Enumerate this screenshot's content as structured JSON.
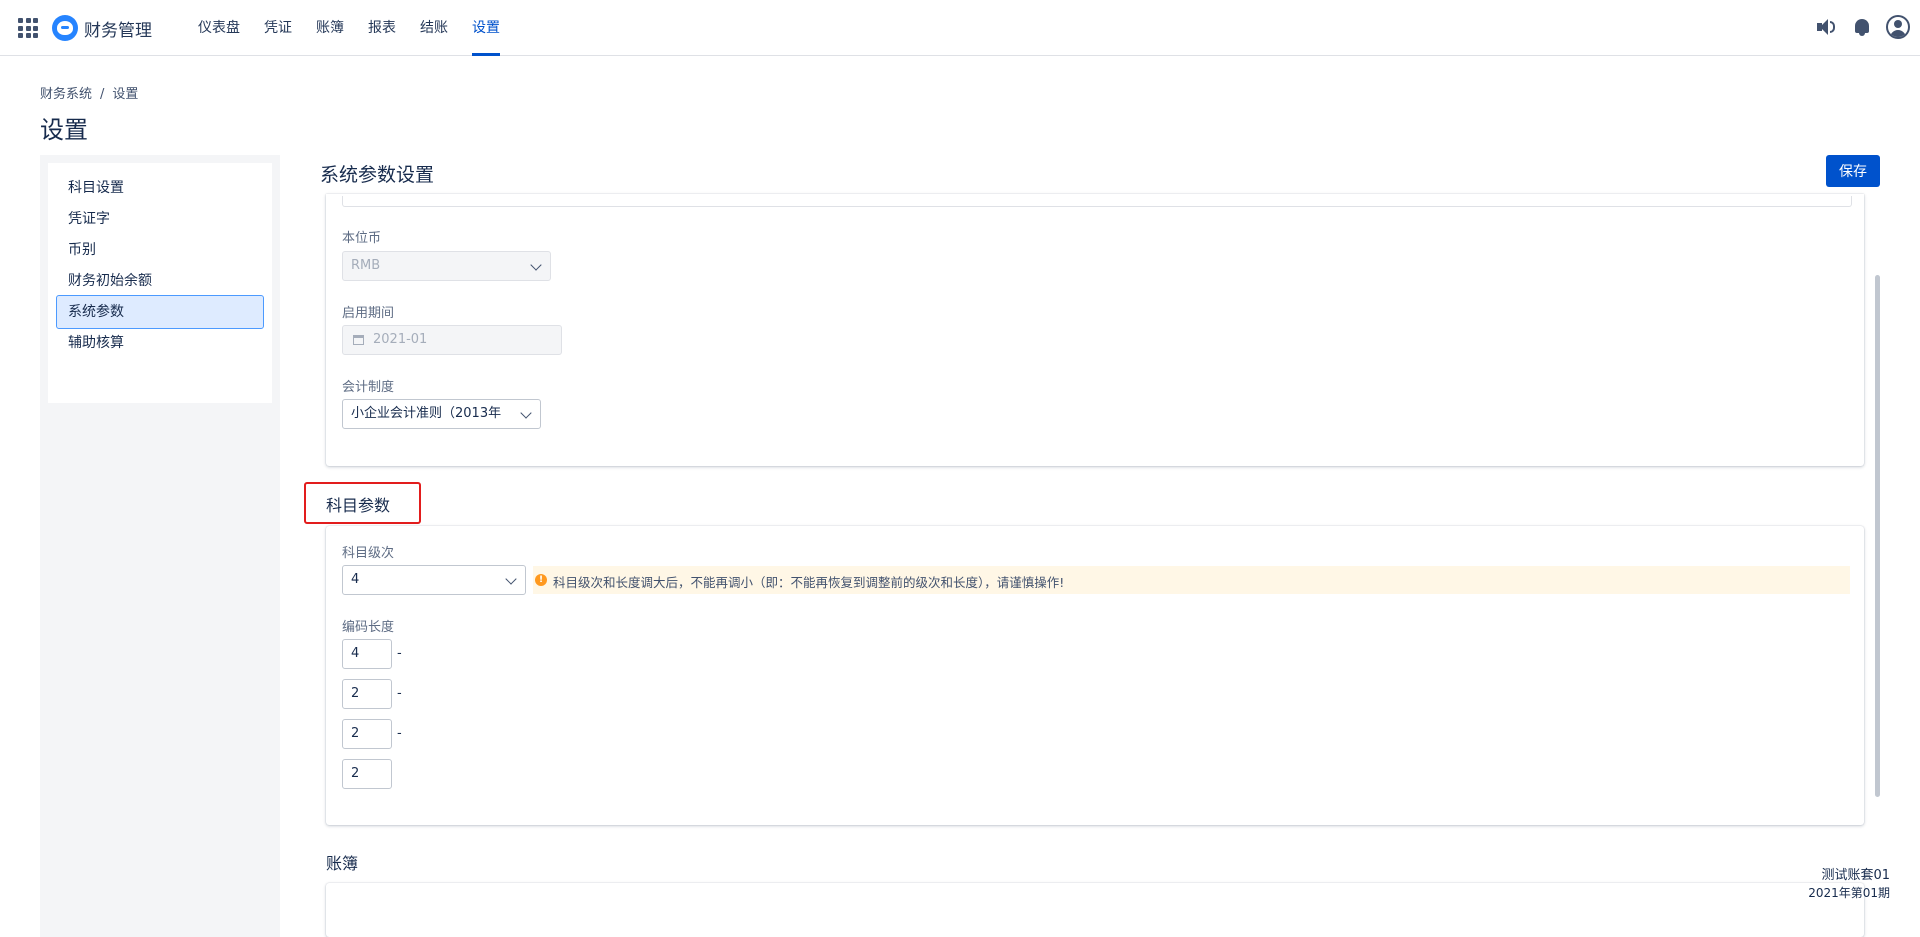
{
  "app": {
    "title": "财务管理",
    "nav": [
      "仪表盘",
      "凭证",
      "账簿",
      "报表",
      "结账",
      "设置"
    ],
    "active_nav": "设置"
  },
  "breadcrumb": [
    "财务系统",
    "设置"
  ],
  "page_title": "设置",
  "sidebar": {
    "items": [
      {
        "label": "科目设置"
      },
      {
        "label": "凭证字"
      },
      {
        "label": "币别"
      },
      {
        "label": "财务初始余额"
      },
      {
        "label": "系统参数",
        "active": true
      },
      {
        "label": "辅助核算"
      }
    ]
  },
  "main": {
    "section_title": "系统参数设置",
    "save_label": "保存",
    "base_currency": {
      "label": "本位币",
      "value": "RMB"
    },
    "start_period": {
      "label": "启用期间",
      "value": "2021-01"
    },
    "accounting_system": {
      "label": "会计制度",
      "value": "小企业会计准则（2013年"
    },
    "subject_params": {
      "title": "科目参数",
      "level": {
        "label": "科目级次",
        "value": "4"
      },
      "warning": "科目级次和长度调大后，不能再调小（即：不能再恢复到调整前的级次和长度），请谨慎操作!",
      "code_length": {
        "label": "编码长度",
        "values": [
          "4",
          "2",
          "2",
          "2"
        ],
        "separator": "-"
      }
    },
    "ledger_title": "账簿"
  },
  "footer": {
    "account_name": "测试账套01",
    "period": "2021年第01期"
  },
  "colors": {
    "accent": "#0052cc",
    "highlight_box": "#e21d1d",
    "warning_bg": "#fff7e6",
    "warning_icon": "#ff991f"
  },
  "icons": [
    "apps-grid-icon",
    "logo-icon",
    "speaker-icon",
    "bell-icon",
    "user-icon",
    "calendar-icon",
    "chevron-down-icon",
    "warning-icon"
  ]
}
